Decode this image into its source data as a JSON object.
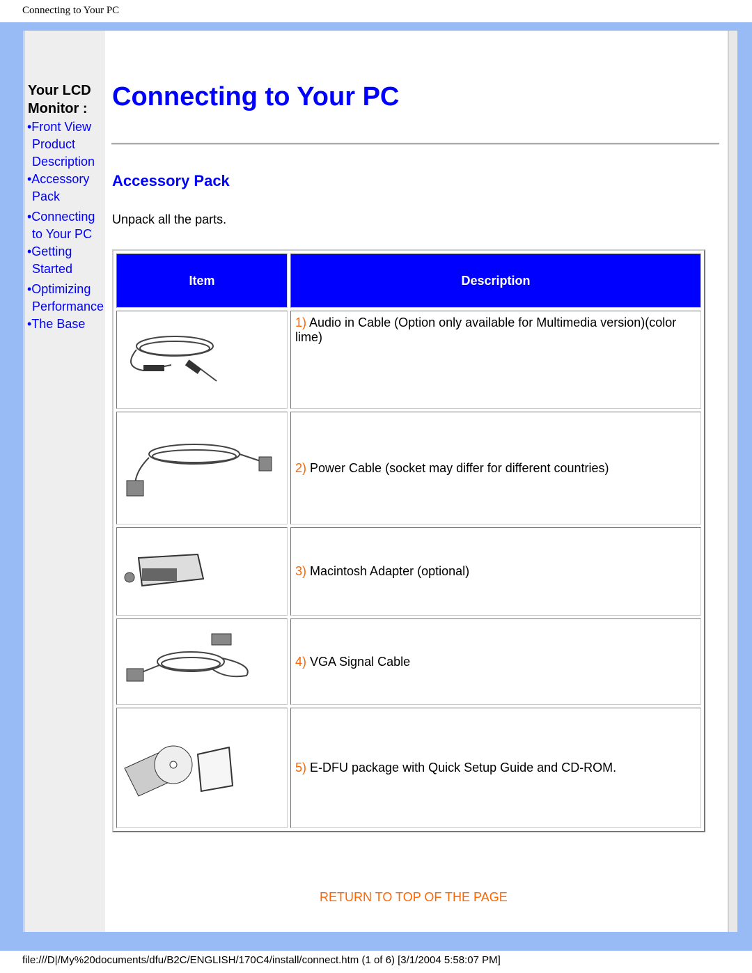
{
  "doc_title": "Connecting to Your PC",
  "sidebar": {
    "title_line1": "Your LCD",
    "title_line2": "Monitor :",
    "items": [
      {
        "line1": "•Front View",
        "line2": "Product",
        "line3": "Description"
      },
      {
        "line1": "•Accessory",
        "line2": "Pack"
      },
      {
        "line1": "•Connecting",
        "line2": "to Your PC"
      },
      {
        "line1": "•Getting",
        "line2": "Started"
      },
      {
        "line1": "•Optimizing",
        "line2": "Performance"
      },
      {
        "line1": "•The Base"
      }
    ]
  },
  "main": {
    "title": "Connecting to Your PC",
    "section": "Accessory Pack",
    "intro": "Unpack all the parts.",
    "table": {
      "headers": [
        "Item",
        "Description"
      ],
      "rows": [
        {
          "num": "1)",
          "text": " Audio in Cable (Option only available for Multimedia version)(color lime)",
          "icon": "audio-cable-image"
        },
        {
          "num": "2)",
          "text": " Power Cable (socket may differ for different countries)",
          "icon": "power-cable-image"
        },
        {
          "num": "3)",
          "text": " Macintosh Adapter (optional)",
          "icon": "mac-adapter-image"
        },
        {
          "num": "4)",
          "text": " VGA Signal Cable",
          "icon": "vga-cable-image"
        },
        {
          "num": "5)",
          "text": " E-DFU package with Quick Setup Guide and CD-ROM.",
          "icon": "edfu-package-image"
        }
      ]
    },
    "return_link": "RETURN TO TOP OF THE PAGE"
  },
  "footer": "file:///D|/My%20documents/dfu/B2C/ENGLISH/170C4/install/connect.htm (1 of 6) [3/1/2004 5:58:07 PM]",
  "colors": {
    "link": "#0000ff",
    "accent": "#ff6600",
    "frame": "#99bbf5"
  }
}
